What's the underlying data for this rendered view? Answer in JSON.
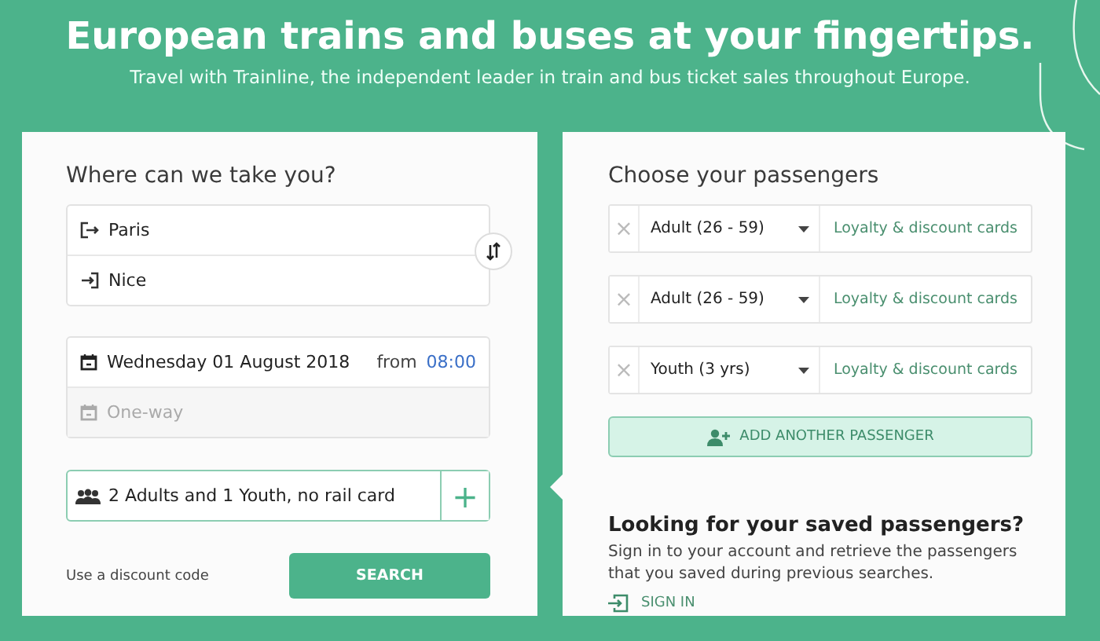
{
  "hero": {
    "title": "European trains and buses at your fingertips.",
    "subtitle": "Travel with Trainline, the independent leader in train and bus ticket sales throughout Europe."
  },
  "journey": {
    "heading": "Where can we take you?",
    "origin": "Paris",
    "destination": "Nice",
    "date": "Wednesday 01 August 2018",
    "time_prefix": "from",
    "time": "08:00",
    "return_placeholder": "One-way",
    "passengers_summary": "2 Adults and 1 Youth, no rail card",
    "add_symbol": "+",
    "discount_link": "Use a discount code",
    "search_button": "SEARCH"
  },
  "passengers": {
    "heading": "Choose your passengers",
    "rows": [
      {
        "remove": "×",
        "type": "Adult (26 - 59)",
        "cards": "Loyalty & discount cards"
      },
      {
        "remove": "×",
        "type": "Adult (26 - 59)",
        "cards": "Loyalty & discount cards"
      },
      {
        "remove": "×",
        "type": "Youth (3 yrs)",
        "cards": "Loyalty & discount cards"
      }
    ],
    "add_button": "ADD ANOTHER PASSENGER",
    "saved_heading": "Looking for your saved passengers?",
    "saved_text": "Sign in to your account and retrieve the passengers that you saved during previous searches.",
    "sign_in": "SIGN IN"
  }
}
